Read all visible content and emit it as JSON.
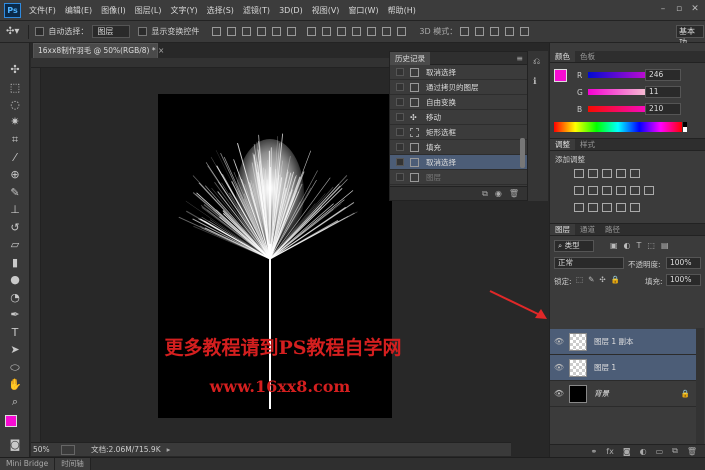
{
  "app": {
    "logo": "Ps"
  },
  "menu": [
    "文件(F)",
    "编辑(E)",
    "图像(I)",
    "图层(L)",
    "文字(Y)",
    "选择(S)",
    "滤镜(T)",
    "3D(D)",
    "视图(V)",
    "窗口(W)",
    "帮助(H)"
  ],
  "options": {
    "auto_select_label": "自动选择：",
    "auto_select_value": "图层",
    "show_transform_label": "显示变换控件",
    "mode_3d_label": "3D 模式：",
    "workspace_btn": "基本功"
  },
  "document": {
    "tab_title": "16xx8制作羽毛 @ 50%(RGB/8) *",
    "watermark_line1": "更多教程请到PS教程自学网",
    "watermark_line2": "www.16xx8.com",
    "colors": {
      "canvas": "#000000",
      "watermark": "#d41f1f"
    }
  },
  "status": {
    "zoom": "50%",
    "doc_info": "文档:2.06M/715.9K"
  },
  "bottom_tabs": [
    "Mini Bridge",
    "时间轴"
  ],
  "history": {
    "title": "历史记录",
    "items": [
      {
        "label": "取消选择",
        "icon": "document-icon",
        "state": "normal"
      },
      {
        "label": "通过拷贝的图层",
        "icon": "document-icon",
        "state": "normal"
      },
      {
        "label": "自由变换",
        "icon": "document-icon",
        "state": "normal"
      },
      {
        "label": "移动",
        "icon": "move-icon",
        "state": "normal"
      },
      {
        "label": "矩形选框",
        "icon": "marquee-icon",
        "state": "normal"
      },
      {
        "label": "填充",
        "icon": "document-icon",
        "state": "normal"
      },
      {
        "label": "取消选择",
        "icon": "document-icon",
        "state": "selected"
      },
      {
        "label": "图层",
        "icon": "document-icon",
        "state": "dimmed"
      }
    ]
  },
  "color_panel": {
    "tabs": [
      "颜色",
      "色板"
    ],
    "r_label": "R",
    "r": "246",
    "g_label": "G",
    "g": "11",
    "b_label": "B",
    "b": "210",
    "foreground": "#f60bd2"
  },
  "adjust_panel": {
    "tabs": [
      "调整",
      "样式"
    ],
    "add_label": "添加调整"
  },
  "layers_panel": {
    "tabs": [
      "图层",
      "通道",
      "路径"
    ],
    "filter_type": "类型",
    "blend_mode": "正常",
    "opacity_label": "不透明度:",
    "opacity": "100%",
    "lock_label": "锁定:",
    "fill_label": "填充:",
    "fill": "100%",
    "layers": [
      {
        "name": "图层 1 副本",
        "thumb": "transparent",
        "selected": true
      },
      {
        "name": "图层 1",
        "thumb": "transparent",
        "selected": true
      },
      {
        "name": "背景",
        "thumb": "black",
        "selected": false,
        "locked": true
      }
    ]
  }
}
